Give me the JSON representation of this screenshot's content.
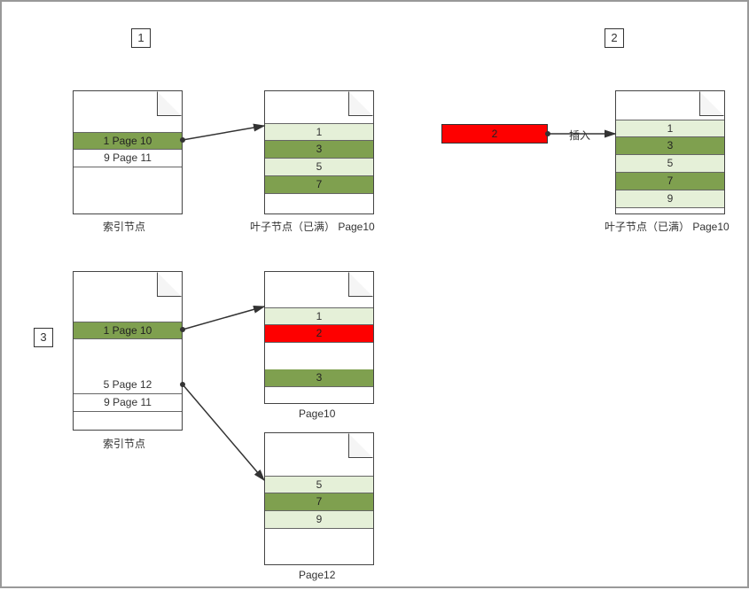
{
  "steps": {
    "s1": "1",
    "s2": "2",
    "s3": "3"
  },
  "panel1": {
    "index_caption": "索引节点",
    "leaf_caption": "叶子节点（已满） Page10",
    "index_rows": [
      "1 Page 10",
      "9 Page 11"
    ],
    "leaf_rows": [
      "1",
      "3",
      "5",
      "7"
    ]
  },
  "panel2": {
    "insert_label": "插入",
    "insert_value": "2",
    "leaf_caption": "叶子节点（已满） Page10",
    "leaf_rows": [
      "1",
      "3",
      "5",
      "7",
      "9"
    ]
  },
  "panel3": {
    "index_caption": "索引节点",
    "leafA_caption": "Page10",
    "leafB_caption": "Page12",
    "index_rows_top": [
      "1 Page 10"
    ],
    "index_rows_bottom": [
      "5 Page 12",
      "9 Page 11"
    ],
    "leafA_rows": [
      "1",
      "2",
      "3"
    ],
    "leafB_rows": [
      "5",
      "7",
      "9"
    ]
  },
  "chart_data": {
    "type": "diagram",
    "description": "B-tree leaf node split on insert",
    "panels": [
      {
        "id": 1,
        "index_node": [
          {
            "key": 1,
            "page": 10
          },
          {
            "key": 9,
            "page": 11
          }
        ],
        "leaf_page10": [
          1,
          3,
          5,
          7
        ],
        "leaf_full": true
      },
      {
        "id": 2,
        "action": "insert",
        "value": 2,
        "leaf_page10": [
          1,
          3,
          5,
          7,
          9
        ],
        "leaf_full": true
      },
      {
        "id": 3,
        "index_node": [
          {
            "key": 1,
            "page": 10
          },
          {
            "key": 5,
            "page": 12
          },
          {
            "key": 9,
            "page": 11
          }
        ],
        "leaf_page10": [
          1,
          2,
          3
        ],
        "leaf_page12": [
          5,
          7,
          9
        ]
      }
    ]
  }
}
